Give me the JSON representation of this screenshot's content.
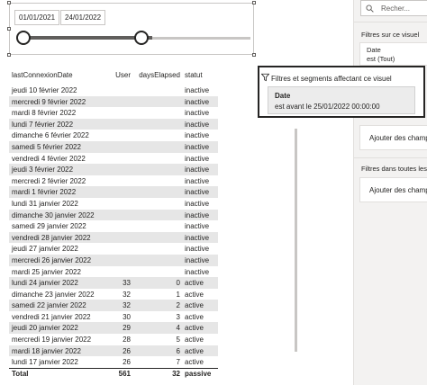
{
  "slicer": {
    "start_date": "01/01/2021",
    "end_date": "24/01/2022"
  },
  "table": {
    "headers": [
      "lastConnexionDate",
      "User",
      "daysElapsed",
      "statut"
    ],
    "rows": [
      [
        "jeudi 10 février 2022",
        "",
        "",
        "inactive"
      ],
      [
        "mercredi 9 février 2022",
        "",
        "",
        "inactive"
      ],
      [
        "mardi 8 février 2022",
        "",
        "",
        "inactive"
      ],
      [
        "lundi 7 février 2022",
        "",
        "",
        "inactive"
      ],
      [
        "dimanche 6 février 2022",
        "",
        "",
        "inactive"
      ],
      [
        "samedi 5 février 2022",
        "",
        "",
        "inactive"
      ],
      [
        "vendredi 4 février 2022",
        "",
        "",
        "inactive"
      ],
      [
        "jeudi 3 février 2022",
        "",
        "",
        "inactive"
      ],
      [
        "mercredi 2 février 2022",
        "",
        "",
        "inactive"
      ],
      [
        "mardi 1 février 2022",
        "",
        "",
        "inactive"
      ],
      [
        "lundi 31 janvier 2022",
        "",
        "",
        "inactive"
      ],
      [
        "dimanche 30 janvier 2022",
        "",
        "",
        "inactive"
      ],
      [
        "samedi 29 janvier 2022",
        "",
        "",
        "inactive"
      ],
      [
        "vendredi 28 janvier 2022",
        "",
        "",
        "inactive"
      ],
      [
        "jeudi 27 janvier 2022",
        "",
        "",
        "inactive"
      ],
      [
        "mercredi 26 janvier 2022",
        "",
        "",
        "inactive"
      ],
      [
        "mardi 25 janvier 2022",
        "",
        "",
        "inactive"
      ],
      [
        "lundi 24 janvier 2022",
        "33",
        "0",
        "active"
      ],
      [
        "dimanche 23 janvier 2022",
        "32",
        "1",
        "active"
      ],
      [
        "samedi 22 janvier 2022",
        "32",
        "2",
        "active"
      ],
      [
        "vendredi 21 janvier 2022",
        "30",
        "3",
        "active"
      ],
      [
        "jeudi 20 janvier 2022",
        "29",
        "4",
        "active"
      ],
      [
        "mercredi 19 janvier 2022",
        "28",
        "5",
        "active"
      ],
      [
        "mardi 18 janvier 2022",
        "26",
        "6",
        "active"
      ],
      [
        "lundi 17 janvier 2022",
        "26",
        "7",
        "active"
      ]
    ],
    "total": [
      "Total",
      "561",
      "32",
      "passive"
    ]
  },
  "tooltip": {
    "title": "Filtres et segments affectant ce visuel",
    "field": "Date",
    "condition": "est avant le 25/01/2022 00:00:00"
  },
  "filter_pane": {
    "search_placeholder": "Recher...",
    "visual_filters_label": "Filtres sur ce visuel",
    "date_filter_name": "Date",
    "date_filter_value": "est (Tout)",
    "add_fields_1": "Ajouter des champs",
    "page_filters_label": "Filtres dans toutes les p",
    "add_fields_2": "Ajouter des champs"
  }
}
